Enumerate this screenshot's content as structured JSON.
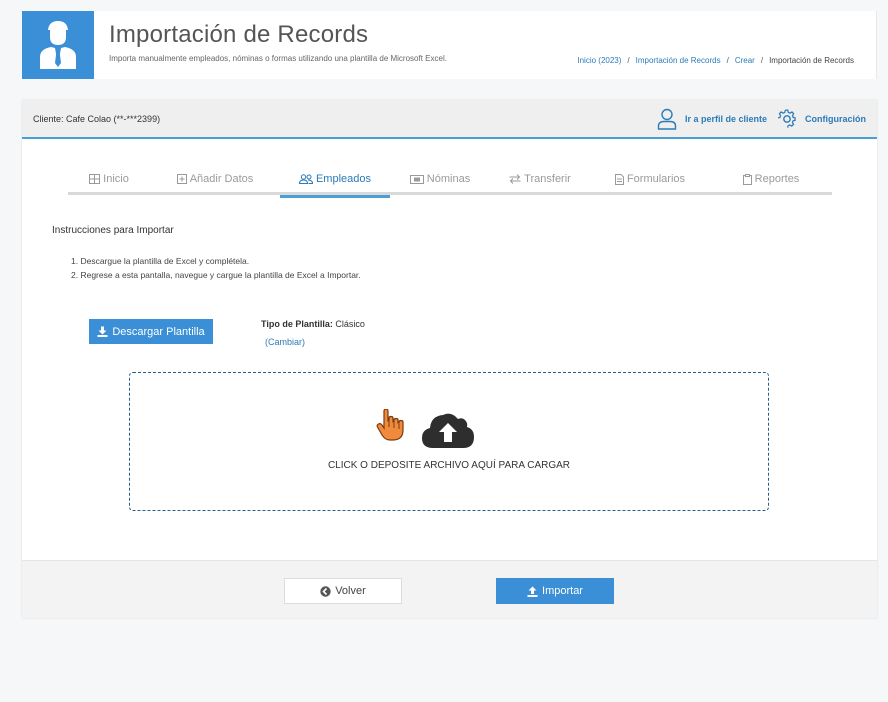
{
  "header": {
    "title": "Importación de Records",
    "subtitle": "Importa manualmente empleados, nóminas o formas utilizando una plantilla de Microsoft Excel.",
    "breadcrumb": [
      {
        "label": "Inicio (2023)"
      },
      {
        "label": "Importación de Records"
      },
      {
        "label": "Crear"
      },
      {
        "label": "Importación de Records"
      }
    ],
    "breadcrumb_separator": "/"
  },
  "card": {
    "client_label": "Cliente: Cafe Colao (**-***2399)",
    "actions": {
      "profile_label": "Ir a perfil de cliente",
      "settings_label": "Configuración"
    }
  },
  "tabs": [
    {
      "label": "Inicio",
      "icon": "grid-icon",
      "active": false
    },
    {
      "label": "Añadir Datos",
      "icon": "plus-square-icon",
      "active": false
    },
    {
      "label": "Empleados",
      "icon": "users-icon",
      "active": true
    },
    {
      "label": "Nóminas",
      "icon": "money-icon",
      "active": false
    },
    {
      "label": "Transferir",
      "icon": "swap-icon",
      "active": false
    },
    {
      "label": "Formularios",
      "icon": "document-icon",
      "active": false
    },
    {
      "label": "Reportes",
      "icon": "clipboard-icon",
      "active": false
    }
  ],
  "instructions": {
    "title": "Instrucciones para Importar",
    "steps": [
      "1. Descargue la plantilla de Excel y complétela.",
      "2. Regrese a esta pantalla, navegue y cargue la plantilla de Excel a Importar."
    ]
  },
  "download_button": "Descargar Plantilla",
  "template": {
    "label": "Tipo de Plantilla:",
    "value": "Clásico",
    "change_link": "(Cambiar)"
  },
  "dropzone": {
    "text": "CLICK O DEPOSITE ARCHIVO AQUÍ PARA CARGAR"
  },
  "footer": {
    "back_label": "Volver",
    "import_label": "Importar"
  },
  "colors": {
    "accent": "#3a8fd6",
    "link": "#2b7bb9",
    "tab_inactive": "#9a9a9a",
    "cursor_hand": "#f08a3c"
  }
}
